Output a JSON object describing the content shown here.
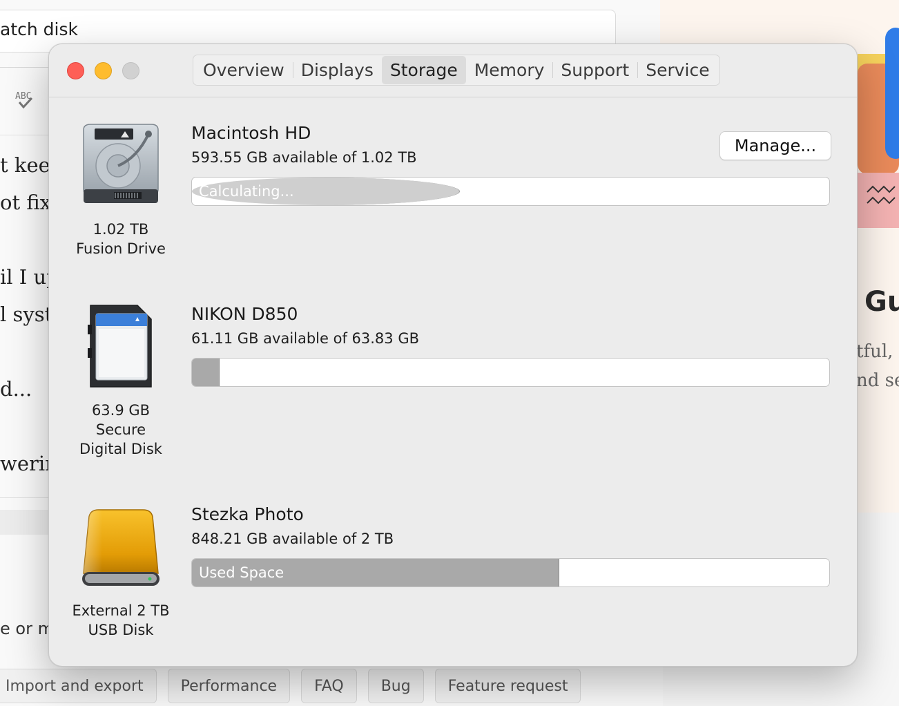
{
  "background": {
    "search_text": "atch disk",
    "spell_icon": "spellcheck-abc-icon",
    "text_fragments": [
      "t keep",
      "ot fix",
      "il I up",
      "l syste",
      "d...",
      "werin"
    ],
    "bottom_left_fragment": "e or m",
    "right_heading": "Gu",
    "right_paragraph": [
      "tful, g",
      "nd se"
    ],
    "tags": [
      "Import and export",
      "Performance",
      "FAQ",
      "Bug",
      "Feature request"
    ]
  },
  "window": {
    "traffic_lights": {
      "close": "#fe5f57",
      "minimize": "#febc2e",
      "zoom": "#d1d1d1"
    },
    "tabs": [
      {
        "label": "Overview",
        "active": false
      },
      {
        "label": "Displays",
        "active": false
      },
      {
        "label": "Storage",
        "active": true
      },
      {
        "label": "Memory",
        "active": false
      },
      {
        "label": "Support",
        "active": false
      },
      {
        "label": "Service",
        "active": false
      }
    ],
    "manage_button": "Manage...",
    "drives": [
      {
        "name": "Macintosh HD",
        "available": "593.55 GB available of 1.02 TB",
        "caption_line1": "1.02 TB",
        "caption_line2": "Fusion Drive",
        "bar_label": "Calculating...",
        "used_fraction": 0.42,
        "icon": "internal-hard-drive-icon"
      },
      {
        "name": "NIKON D850",
        "available": "61.11 GB available of 63.83 GB",
        "caption_line1": "63.9 GB",
        "caption_line2": "Secure",
        "caption_line3": "Digital Disk",
        "bar_label": "",
        "used_fraction": 0.043,
        "icon": "sd-card-icon"
      },
      {
        "name": "Stezka Photo",
        "available": "848.21 GB available of 2 TB",
        "caption_line1": "External 2 TB",
        "caption_line2": "USB Disk",
        "bar_label": "Used Space",
        "used_fraction": 0.576,
        "icon": "external-usb-drive-icon"
      }
    ]
  }
}
